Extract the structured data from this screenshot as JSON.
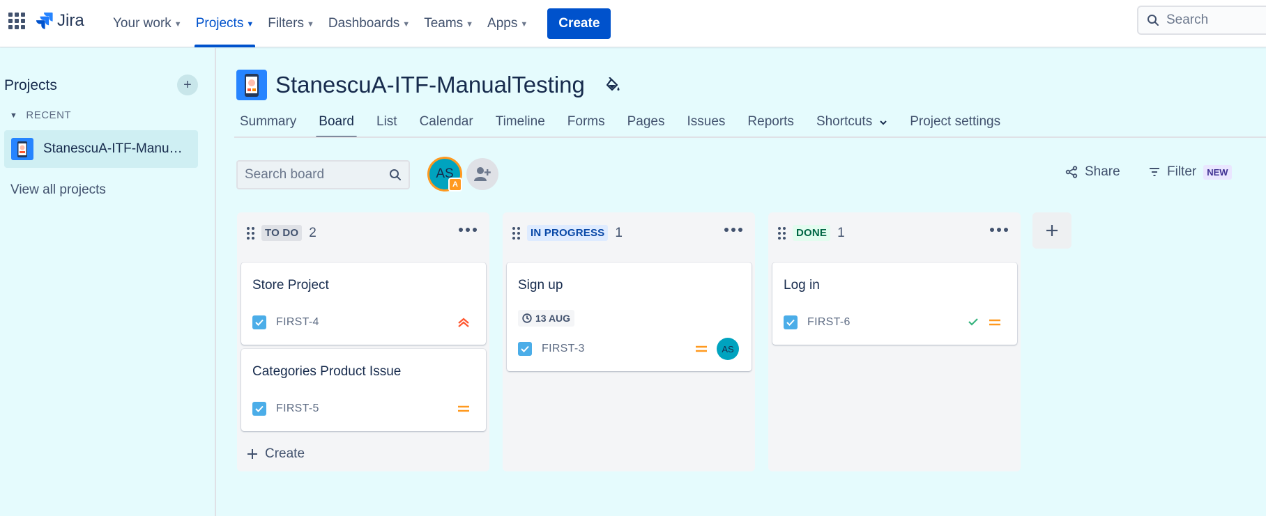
{
  "topnav": {
    "logo_text": "Jira",
    "items": [
      {
        "label": "Your work"
      },
      {
        "label": "Projects"
      },
      {
        "label": "Filters"
      },
      {
        "label": "Dashboards"
      },
      {
        "label": "Teams"
      },
      {
        "label": "Apps"
      }
    ],
    "create_label": "Create",
    "search_placeholder": "Search"
  },
  "sidebar": {
    "title": "Projects",
    "recent_label": "RECENT",
    "project_name": "StanescuA-ITF-ManualTesting",
    "view_all": "View all projects"
  },
  "project": {
    "title": "StanescuA-ITF-ManualTesting",
    "tabs": [
      {
        "label": "Summary"
      },
      {
        "label": "Board"
      },
      {
        "label": "List"
      },
      {
        "label": "Calendar"
      },
      {
        "label": "Timeline"
      },
      {
        "label": "Forms"
      },
      {
        "label": "Pages"
      },
      {
        "label": "Issues"
      },
      {
        "label": "Reports"
      },
      {
        "label": "Shortcuts"
      },
      {
        "label": "Project settings"
      }
    ],
    "active_tab": "Board"
  },
  "toolbar": {
    "search_placeholder": "Search board",
    "avatar_initials": "AS",
    "avatar_badge": "A",
    "share_label": "Share",
    "filter_label": "Filter",
    "filter_badge": "NEW"
  },
  "columns": [
    {
      "status": "TO DO",
      "count": "2",
      "cards": [
        {
          "title": "Store Project",
          "key": "FIRST-4",
          "priority": "highest"
        },
        {
          "title": "Categories Product Issue",
          "key": "FIRST-5",
          "priority": "medium"
        }
      ],
      "create_label": "Create"
    },
    {
      "status": "IN PROGRESS",
      "count": "1",
      "cards": [
        {
          "title": "Sign up",
          "key": "FIRST-3",
          "due": "13 AUG",
          "priority": "medium",
          "assignee": "AS"
        }
      ]
    },
    {
      "status": "DONE",
      "count": "1",
      "cards": [
        {
          "title": "Log in",
          "key": "FIRST-6",
          "priority": "medium",
          "done": true
        }
      ]
    }
  ],
  "colors": {
    "brand": "#0052cc",
    "background": "#e5fbfd",
    "priority_medium": "#ff991f",
    "priority_highest": "#ff5630",
    "done_check": "#36b37e"
  }
}
